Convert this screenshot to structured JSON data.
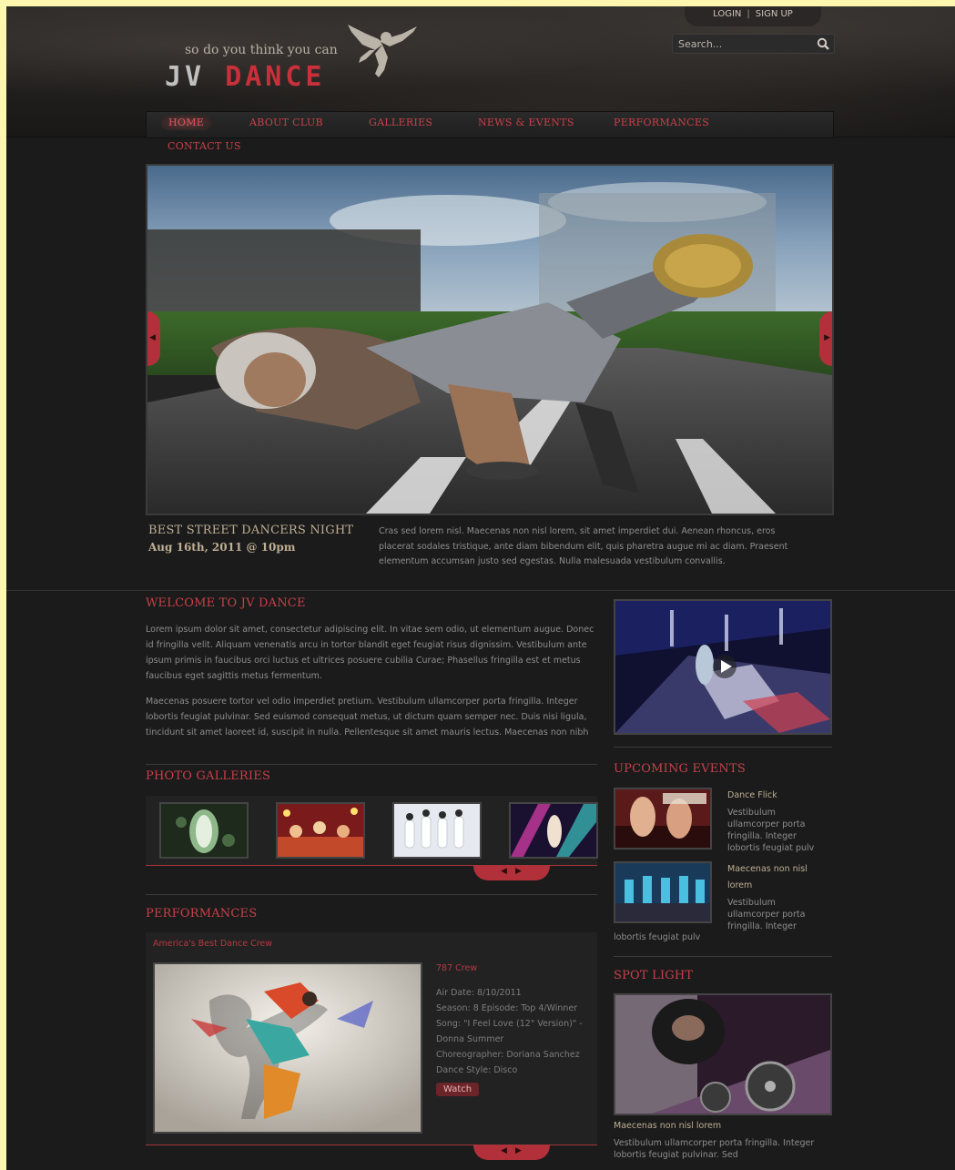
{
  "header": {
    "tagline": "so do you think you can",
    "logo_left": "JV",
    "logo_right": "DANCE",
    "login": "LOGIN",
    "separator": "|",
    "signup": "SIGN UP",
    "search_placeholder": "Search..."
  },
  "nav": {
    "items": [
      {
        "label": "HOME"
      },
      {
        "label": "ABOUT CLUB"
      },
      {
        "label": "GALLERIES"
      },
      {
        "label": "NEWS & EVENTS"
      },
      {
        "label": "PERFORMANCES"
      },
      {
        "label": "CONTACT US"
      }
    ]
  },
  "featured": {
    "title": "BEST STREET DANCERS NIGHT",
    "date": "Aug 16th, 2011 @ 10pm",
    "description": "Cras sed lorem nisl. Maecenas non nisl lorem, sit amet imperdiet dui. Aenean rhoncus, eros placerat sodales tristique, ante diam bibendum elit, quis pharetra augue mi ac diam. Praesent elementum accumsan justo sed egestas. Nulla malesuada vestibulum convallis."
  },
  "welcome": {
    "heading": "WELCOME TO JV DANCE",
    "p1": "Lorem ipsum dolor sit amet, consectetur adipiscing elit. In vitae sem odio, ut elementum augue. Donec id fringilla velit. Aliquam venenatis arcu in tortor blandit eget feugiat risus dignissim. Vestibulum ante ipsum primis in faucibus orci luctus et ultrices posuere cubilia Curae; Phasellus fringilla est et metus faucibus eget sagittis metus fermentum.",
    "p2": "Maecenas posuere tortor vel odio imperdiet pretium. Vestibulum ullamcorper porta fringilla. Integer lobortis feugiat pulvinar. Sed euismod consequat metus, ut dictum quam semper nec. Duis nisi ligula, tincidunt sit amet laoreet id, suscipit in nulla. Pellentesque sit amet mauris lectus. Maecenas non nibh"
  },
  "galleries": {
    "heading": "PHOTO GALLERIES"
  },
  "performances": {
    "heading": "PERFORMANCES",
    "show": "America's Best Dance Crew",
    "crew": "787 Crew",
    "air_date": "Air Date: 8/10/2011",
    "season": "Season: 8 Episode: Top 4/Winner",
    "song": "Song: \"I Feel Love (12\" Version)\" - Donna Summer",
    "choreographer": "Choreographer: Doriana Sanchez",
    "style": "Dance Style: Disco",
    "watch": "Watch"
  },
  "upcoming": {
    "heading": "UPCOMING EVENTS",
    "events": [
      {
        "title": "Dance Flick",
        "text": "Vestibulum ullamcorper porta fringilla. Integer lobortis feugiat pulv"
      },
      {
        "title": "Maecenas non nisl lorem",
        "text": "Vestibulum ullamcorper porta fringilla. Integer",
        "text_tail": "lobortis feugiat pulv"
      }
    ]
  },
  "spotlight": {
    "heading": "SPOT LIGHT",
    "title": "Maecenas non nisl lorem",
    "text": "Vestibulum ullamcorper porta fringilla. Integer lobortis feugiat pulvinar. Sed"
  },
  "pager": {
    "prev": "◀",
    "next": "▶"
  },
  "colors": {
    "accent": "#c8404a",
    "background": "#1b1b1b",
    "gold_text": "#bfae94"
  }
}
